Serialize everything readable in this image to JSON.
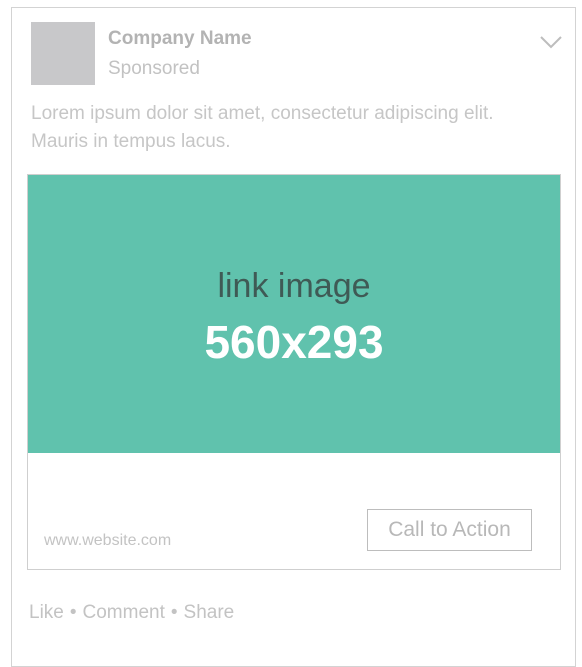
{
  "post": {
    "company_name": "Company Name",
    "sponsored_label": "Sponsored",
    "caption": "Lorem ipsum dolor sit amet, consectetur adipiscing elit. Mauris in tempus lacus.",
    "menu_icon": "chevron-down-icon"
  },
  "link": {
    "image_label": "link image",
    "image_size": "560x293",
    "image_color": "#60c2ad",
    "website": "www.website.com",
    "cta_label": "Call to Action"
  },
  "actions": {
    "like": "Like",
    "comment": "Comment",
    "share": "Share",
    "separator": "•"
  }
}
